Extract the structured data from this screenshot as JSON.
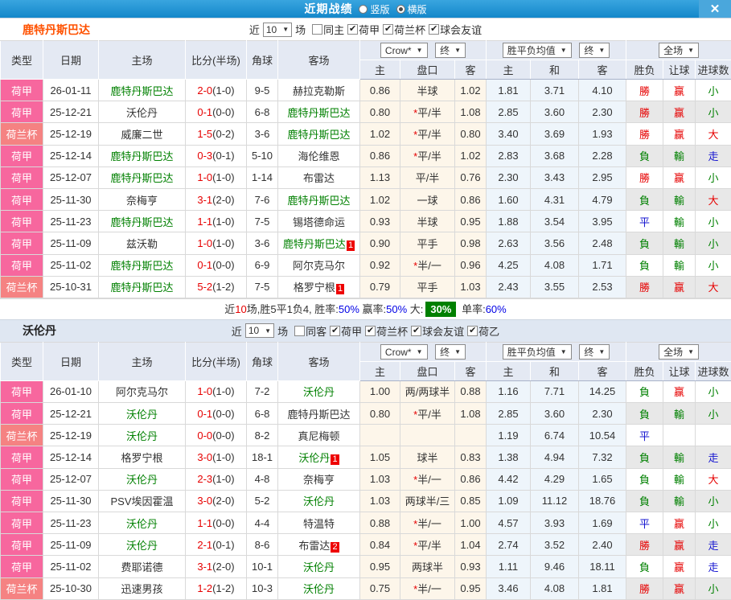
{
  "titlebar": {
    "title": "近期战绩",
    "radios": [
      {
        "label": "竖版",
        "selected": false
      },
      {
        "label": "横版",
        "selected": true
      }
    ],
    "close": "✕"
  },
  "columns": {
    "left": [
      "类型",
      "日期",
      "主场",
      "比分(半场)",
      "角球",
      "客场"
    ],
    "bookmaker_dd": "Crow*",
    "stage_dd1": "终",
    "avg_dd": "胜平负均值",
    "stage_dd2": "终",
    "scope_dd": "全场",
    "sub": [
      "主",
      "盘口",
      "客",
      "主",
      "和",
      "客",
      "胜负",
      "让球",
      "进球数"
    ]
  },
  "sections": [
    {
      "team": "鹿特丹斯巴达",
      "controls": {
        "near": "近",
        "count": "10",
        "suffix": "场",
        "filters": [
          {
            "label": "同主",
            "checked": false
          },
          {
            "label": "荷甲",
            "checked": true
          },
          {
            "label": "荷兰杯",
            "checked": true
          },
          {
            "label": "球会友谊",
            "checked": true
          }
        ]
      },
      "rows": [
        {
          "type": "荷甲",
          "type_cls": "t-league",
          "date": "26-01-11",
          "home": "鹿特丹斯巴达",
          "home_cls": "team-green",
          "home_badge": "",
          "score": "2-0",
          "half": "(1-0)",
          "corner": "9-5",
          "away": "赫拉克勒斯",
          "away_cls": "",
          "away_badge": "",
          "o1": "0.86",
          "star": "",
          "hc": "半球",
          "o3": "1.02",
          "a1": "1.81",
          "a2": "3.71",
          "a3": "4.10",
          "r1": "勝",
          "r1_cls": "c-red",
          "r2": "赢",
          "r2_cls": "c-red",
          "r3": "小",
          "r3_cls": "c-green"
        },
        {
          "type": "荷甲",
          "type_cls": "t-league",
          "date": "25-12-21",
          "home": "沃伦丹",
          "home_cls": "",
          "home_badge": "",
          "score": "0-1",
          "half": "(0-0)",
          "corner": "6-8",
          "away": "鹿特丹斯巴达",
          "away_cls": "team-green",
          "away_badge": "",
          "o1": "0.80",
          "star": "*",
          "hc": "平/半",
          "o3": "1.08",
          "a1": "2.85",
          "a2": "3.60",
          "a3": "2.30",
          "r1": "勝",
          "r1_cls": "c-red",
          "r2": "赢",
          "r2_cls": "c-red",
          "r3": "小",
          "r3_cls": "c-green"
        },
        {
          "type": "荷兰杯",
          "type_cls": "t-cup",
          "date": "25-12-19",
          "home": "威廉二世",
          "home_cls": "",
          "home_badge": "",
          "score": "1-5",
          "half": "(0-2)",
          "corner": "3-6",
          "away": "鹿特丹斯巴达",
          "away_cls": "team-green",
          "away_badge": "",
          "o1": "1.02",
          "star": "*",
          "hc": "平/半",
          "o3": "0.80",
          "a1": "3.40",
          "a2": "3.69",
          "a3": "1.93",
          "r1": "勝",
          "r1_cls": "c-red",
          "r2": "赢",
          "r2_cls": "c-red",
          "r3": "大",
          "r3_cls": "c-red"
        },
        {
          "type": "荷甲",
          "type_cls": "t-league",
          "date": "25-12-14",
          "home": "鹿特丹斯巴达",
          "home_cls": "team-green",
          "home_badge": "",
          "score": "0-3",
          "half": "(0-1)",
          "corner": "5-10",
          "away": "海伦维恩",
          "away_cls": "",
          "away_badge": "",
          "o1": "0.86",
          "star": "*",
          "hc": "平/半",
          "o3": "1.02",
          "a1": "2.83",
          "a2": "3.68",
          "a3": "2.28",
          "r1": "負",
          "r1_cls": "c-green",
          "r2": "輸",
          "r2_cls": "c-green",
          "r3": "走",
          "r3_cls": "c-blue"
        },
        {
          "type": "荷甲",
          "type_cls": "t-league",
          "date": "25-12-07",
          "home": "鹿特丹斯巴达",
          "home_cls": "team-green",
          "home_badge": "",
          "score": "1-0",
          "half": "(1-0)",
          "corner": "1-14",
          "away": "布雷达",
          "away_cls": "",
          "away_badge": "",
          "o1": "1.13",
          "star": "",
          "hc": "平/半",
          "o3": "0.76",
          "a1": "2.30",
          "a2": "3.43",
          "a3": "2.95",
          "r1": "勝",
          "r1_cls": "c-red",
          "r2": "赢",
          "r2_cls": "c-red",
          "r3": "小",
          "r3_cls": "c-green"
        },
        {
          "type": "荷甲",
          "type_cls": "t-league",
          "date": "25-11-30",
          "home": "奈梅亨",
          "home_cls": "",
          "home_badge": "",
          "score": "3-1",
          "half": "(2-0)",
          "corner": "7-6",
          "away": "鹿特丹斯巴达",
          "away_cls": "team-green",
          "away_badge": "",
          "o1": "1.02",
          "star": "",
          "hc": "一球",
          "o3": "0.86",
          "a1": "1.60",
          "a2": "4.31",
          "a3": "4.79",
          "r1": "負",
          "r1_cls": "c-green",
          "r2": "輸",
          "r2_cls": "c-green",
          "r3": "大",
          "r3_cls": "c-red"
        },
        {
          "type": "荷甲",
          "type_cls": "t-league",
          "date": "25-11-23",
          "home": "鹿特丹斯巴达",
          "home_cls": "team-green",
          "home_badge": "",
          "score": "1-1",
          "half": "(1-0)",
          "corner": "7-5",
          "away": "锡塔德命运",
          "away_cls": "",
          "away_badge": "",
          "o1": "0.93",
          "star": "",
          "hc": "半球",
          "o3": "0.95",
          "a1": "1.88",
          "a2": "3.54",
          "a3": "3.95",
          "r1": "平",
          "r1_cls": "c-blue",
          "r2": "輸",
          "r2_cls": "c-green",
          "r3": "小",
          "r3_cls": "c-green"
        },
        {
          "type": "荷甲",
          "type_cls": "t-league",
          "date": "25-11-09",
          "home": "兹沃勒",
          "home_cls": "",
          "home_badge": "",
          "score": "1-0",
          "half": "(1-0)",
          "corner": "3-6",
          "away": "鹿特丹斯巴达",
          "away_cls": "team-green",
          "away_badge": "1",
          "o1": "0.90",
          "star": "",
          "hc": "平手",
          "o3": "0.98",
          "a1": "2.63",
          "a2": "3.56",
          "a3": "2.48",
          "r1": "負",
          "r1_cls": "c-green",
          "r2": "輸",
          "r2_cls": "c-green",
          "r3": "小",
          "r3_cls": "c-green"
        },
        {
          "type": "荷甲",
          "type_cls": "t-league",
          "date": "25-11-02",
          "home": "鹿特丹斯巴达",
          "home_cls": "team-green",
          "home_badge": "",
          "score": "0-1",
          "half": "(0-0)",
          "corner": "6-9",
          "away": "阿尔克马尔",
          "away_cls": "",
          "away_badge": "",
          "o1": "0.92",
          "star": "*",
          "hc": "半/一",
          "o3": "0.96",
          "a1": "4.25",
          "a2": "4.08",
          "a3": "1.71",
          "r1": "負",
          "r1_cls": "c-green",
          "r2": "輸",
          "r2_cls": "c-green",
          "r3": "小",
          "r3_cls": "c-green"
        },
        {
          "type": "荷兰杯",
          "type_cls": "t-cup",
          "date": "25-10-31",
          "home": "鹿特丹斯巴达",
          "home_cls": "team-green",
          "home_badge": "",
          "score": "5-2",
          "half": "(1-2)",
          "corner": "7-5",
          "away": "格罗宁根",
          "away_cls": "",
          "away_badge": "1",
          "o1": "0.79",
          "star": "",
          "hc": "平手",
          "o3": "1.03",
          "a1": "2.43",
          "a2": "3.55",
          "a3": "2.53",
          "r1": "勝",
          "r1_cls": "c-red",
          "r2": "赢",
          "r2_cls": "c-red",
          "r3": "大",
          "r3_cls": "c-red"
        }
      ],
      "summary": [
        {
          "t": "近"
        },
        {
          "t": "10",
          "cls": "s-red"
        },
        {
          "t": "场,胜5平1负4, 胜率:"
        },
        {
          "t": "50%",
          "cls": "s-blue"
        },
        {
          "t": " 赢率:"
        },
        {
          "t": "50%",
          "cls": "s-blue"
        },
        {
          "t": " 大:"
        },
        {
          "t": "30%",
          "cls": "s-greenbox"
        },
        {
          "t": " 单率:"
        },
        {
          "t": "60%",
          "cls": "s-blue"
        }
      ]
    },
    {
      "team": "沃伦丹",
      "controls": {
        "near": "近",
        "count": "10",
        "suffix": "场",
        "filters": [
          {
            "label": "同客",
            "checked": false
          },
          {
            "label": "荷甲",
            "checked": true
          },
          {
            "label": "荷兰杯",
            "checked": true
          },
          {
            "label": "球会友谊",
            "checked": true
          },
          {
            "label": "荷乙",
            "checked": true
          }
        ]
      },
      "rows": [
        {
          "type": "荷甲",
          "type_cls": "t-league",
          "date": "26-01-10",
          "home": "阿尔克马尔",
          "home_cls": "",
          "home_badge": "",
          "score": "1-0",
          "half": "(1-0)",
          "corner": "7-2",
          "away": "沃伦丹",
          "away_cls": "team-green",
          "away_badge": "",
          "o1": "1.00",
          "star": "",
          "hc": "两/两球半",
          "o3": "0.88",
          "a1": "1.16",
          "a2": "7.71",
          "a3": "14.25",
          "r1": "負",
          "r1_cls": "c-green",
          "r2": "赢",
          "r2_cls": "c-red",
          "r3": "小",
          "r3_cls": "c-green"
        },
        {
          "type": "荷甲",
          "type_cls": "t-league",
          "date": "25-12-21",
          "home": "沃伦丹",
          "home_cls": "team-green",
          "home_badge": "",
          "score": "0-1",
          "half": "(0-0)",
          "corner": "6-8",
          "away": "鹿特丹斯巴达",
          "away_cls": "",
          "away_badge": "",
          "o1": "0.80",
          "star": "*",
          "hc": "平/半",
          "o3": "1.08",
          "a1": "2.85",
          "a2": "3.60",
          "a3": "2.30",
          "r1": "負",
          "r1_cls": "c-green",
          "r2": "輸",
          "r2_cls": "c-green",
          "r3": "小",
          "r3_cls": "c-green"
        },
        {
          "type": "荷兰杯",
          "type_cls": "t-cup",
          "date": "25-12-19",
          "home": "沃伦丹",
          "home_cls": "team-green",
          "home_badge": "",
          "score": "0-0",
          "half": "(0-0)",
          "corner": "8-2",
          "away": "真尼梅顿",
          "away_cls": "",
          "away_badge": "",
          "o1": "",
          "star": "",
          "hc": "",
          "o3": "",
          "a1": "1.19",
          "a2": "6.74",
          "a3": "10.54",
          "r1": "平",
          "r1_cls": "c-blue",
          "r2": "",
          "r2_cls": "",
          "r3": "",
          "r3_cls": ""
        },
        {
          "type": "荷甲",
          "type_cls": "t-league",
          "date": "25-12-14",
          "home": "格罗宁根",
          "home_cls": "",
          "home_badge": "",
          "score": "3-0",
          "half": "(1-0)",
          "corner": "18-1",
          "away": "沃伦丹",
          "away_cls": "team-green",
          "away_badge": "1",
          "o1": "1.05",
          "star": "",
          "hc": "球半",
          "o3": "0.83",
          "a1": "1.38",
          "a2": "4.94",
          "a3": "7.32",
          "r1": "負",
          "r1_cls": "c-green",
          "r2": "輸",
          "r2_cls": "c-green",
          "r3": "走",
          "r3_cls": "c-blue"
        },
        {
          "type": "荷甲",
          "type_cls": "t-league",
          "date": "25-12-07",
          "home": "沃伦丹",
          "home_cls": "team-green",
          "home_badge": "",
          "score": "2-3",
          "half": "(1-0)",
          "corner": "4-8",
          "away": "奈梅亨",
          "away_cls": "",
          "away_badge": "",
          "o1": "1.03",
          "star": "*",
          "hc": "半/一",
          "o3": "0.86",
          "a1": "4.42",
          "a2": "4.29",
          "a3": "1.65",
          "r1": "負",
          "r1_cls": "c-green",
          "r2": "輸",
          "r2_cls": "c-green",
          "r3": "大",
          "r3_cls": "c-red"
        },
        {
          "type": "荷甲",
          "type_cls": "t-league",
          "date": "25-11-30",
          "home": "PSV埃因霍温",
          "home_cls": "",
          "home_badge": "",
          "score": "3-0",
          "half": "(2-0)",
          "corner": "5-2",
          "away": "沃伦丹",
          "away_cls": "team-green",
          "away_badge": "",
          "o1": "1.03",
          "star": "",
          "hc": "两球半/三",
          "o3": "0.85",
          "a1": "1.09",
          "a2": "11.12",
          "a3": "18.76",
          "r1": "負",
          "r1_cls": "c-green",
          "r2": "輸",
          "r2_cls": "c-green",
          "r3": "小",
          "r3_cls": "c-green"
        },
        {
          "type": "荷甲",
          "type_cls": "t-league",
          "date": "25-11-23",
          "home": "沃伦丹",
          "home_cls": "team-green",
          "home_badge": "",
          "score": "1-1",
          "half": "(0-0)",
          "corner": "4-4",
          "away": "特温特",
          "away_cls": "",
          "away_badge": "",
          "o1": "0.88",
          "star": "*",
          "hc": "半/一",
          "o3": "1.00",
          "a1": "4.57",
          "a2": "3.93",
          "a3": "1.69",
          "r1": "平",
          "r1_cls": "c-blue",
          "r2": "赢",
          "r2_cls": "c-red",
          "r3": "小",
          "r3_cls": "c-green"
        },
        {
          "type": "荷甲",
          "type_cls": "t-league",
          "date": "25-11-09",
          "home": "沃伦丹",
          "home_cls": "team-green",
          "home_badge": "",
          "score": "2-1",
          "half": "(0-1)",
          "corner": "8-6",
          "away": "布雷达",
          "away_cls": "",
          "away_badge": "2",
          "o1": "0.84",
          "star": "*",
          "hc": "平/半",
          "o3": "1.04",
          "a1": "2.74",
          "a2": "3.52",
          "a3": "2.40",
          "r1": "勝",
          "r1_cls": "c-red",
          "r2": "赢",
          "r2_cls": "c-red",
          "r3": "走",
          "r3_cls": "c-blue"
        },
        {
          "type": "荷甲",
          "type_cls": "t-league",
          "date": "25-11-02",
          "home": "费耶诺德",
          "home_cls": "",
          "home_badge": "",
          "score": "3-1",
          "half": "(2-0)",
          "corner": "10-1",
          "away": "沃伦丹",
          "away_cls": "team-green",
          "away_badge": "",
          "o1": "0.95",
          "star": "",
          "hc": "两球半",
          "o3": "0.93",
          "a1": "1.11",
          "a2": "9.46",
          "a3": "18.11",
          "r1": "負",
          "r1_cls": "c-green",
          "r2": "赢",
          "r2_cls": "c-red",
          "r3": "走",
          "r3_cls": "c-blue"
        },
        {
          "type": "荷兰杯",
          "type_cls": "t-cup",
          "date": "25-10-30",
          "home": "迅速男孩",
          "home_cls": "",
          "home_badge": "",
          "score": "1-2",
          "half": "(1-2)",
          "corner": "10-3",
          "away": "沃伦丹",
          "away_cls": "team-green",
          "away_badge": "",
          "o1": "0.75",
          "star": "*",
          "hc": "半/一",
          "o3": "0.95",
          "a1": "3.46",
          "a2": "4.08",
          "a3": "1.81",
          "r1": "勝",
          "r1_cls": "c-red",
          "r2": "赢",
          "r2_cls": "c-red",
          "r3": "小",
          "r3_cls": "c-green"
        }
      ],
      "summary": null
    }
  ]
}
